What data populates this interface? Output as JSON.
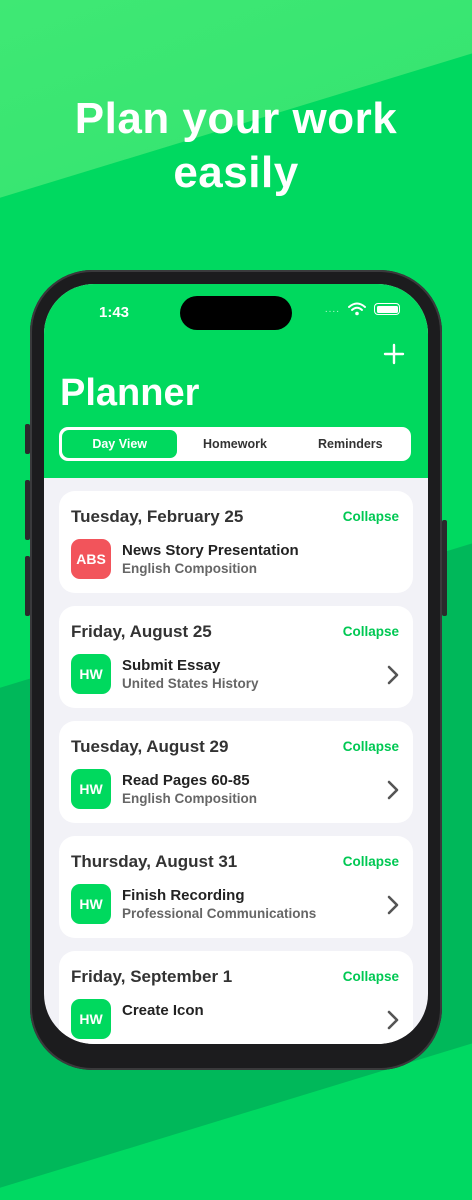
{
  "headline": {
    "line1": "Plan your work",
    "line2": "easily"
  },
  "status_bar": {
    "time": "1:43",
    "signal": "....",
    "wifi_icon": "wifi-icon",
    "battery_icon": "battery-icon"
  },
  "header": {
    "title": "Planner",
    "add_icon": "plus-icon"
  },
  "segments": [
    {
      "label": "Day View",
      "active": true
    },
    {
      "label": "Homework",
      "active": false
    },
    {
      "label": "Reminders",
      "active": false
    }
  ],
  "colors": {
    "brand": "#00d95e",
    "accent_text": "#00c853",
    "abs_badge": "#f2545b",
    "hw_badge": "#00d95e"
  },
  "cards": [
    {
      "date": "Tuesday, February 25",
      "action": "Collapse",
      "badge": "ABS",
      "badge_color": "#f2545b",
      "title": "News Story Presentation",
      "subtitle": "English Composition",
      "has_chevron": false
    },
    {
      "date": "Friday, August 25",
      "action": "Collapse",
      "badge": "HW",
      "badge_color": "#00d95e",
      "title": "Submit Essay",
      "subtitle": "United States History",
      "has_chevron": true
    },
    {
      "date": "Tuesday, August 29",
      "action": "Collapse",
      "badge": "HW",
      "badge_color": "#00d95e",
      "title": "Read Pages 60-85",
      "subtitle": "English Composition",
      "has_chevron": true
    },
    {
      "date": "Thursday, August 31",
      "action": "Collapse",
      "badge": "HW",
      "badge_color": "#00d95e",
      "title": "Finish Recording",
      "subtitle": "Professional Communications",
      "has_chevron": true
    },
    {
      "date": "Friday, September 1",
      "action": "Collapse",
      "badge": "HW",
      "badge_color": "#00d95e",
      "title": "Create Icon",
      "subtitle": "",
      "has_chevron": true
    }
  ]
}
